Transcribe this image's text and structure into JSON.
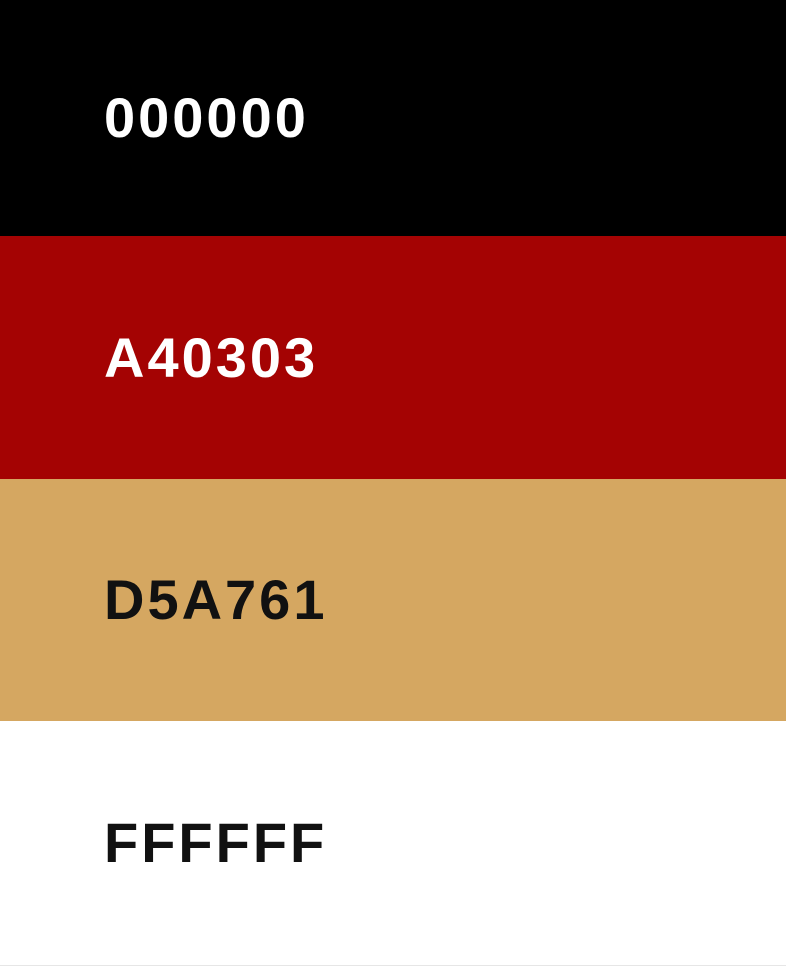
{
  "swatches": [
    {
      "hex": "000000",
      "color": "#000000",
      "text_color": "#ffffff"
    },
    {
      "hex": "A40303",
      "color": "#A40303",
      "text_color": "#ffffff"
    },
    {
      "hex": "D5A761",
      "color": "#D5A761",
      "text_color": "#111111"
    },
    {
      "hex": "FFFFFF",
      "color": "#FFFFFF",
      "text_color": "#111111"
    }
  ]
}
